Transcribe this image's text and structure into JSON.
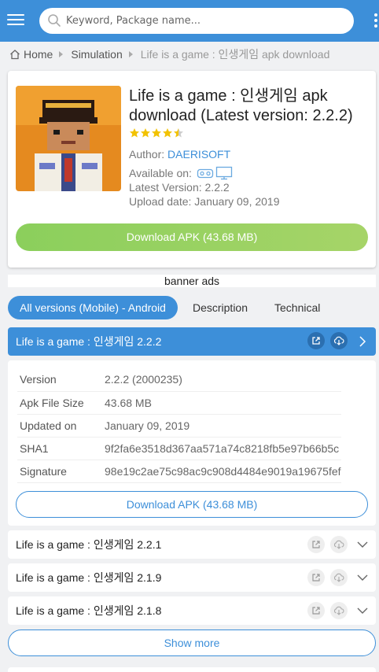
{
  "header": {
    "search_placeholder": "Keyword, Package name...",
    "accent_color": "#3d8fd9"
  },
  "breadcrumb": {
    "home": "Home",
    "category": "Simulation",
    "current": "Life is a game : 인생게임 apk download"
  },
  "app": {
    "title": "Life is a game : 인생게임 apk download (Latest version: 2.2.2)",
    "rating_stars": 4.5,
    "author_label": "Author:",
    "author": "DAERISOFT",
    "available_label": "Available on:",
    "platform_icons": [
      "vr-headset-icon",
      "tv-icon"
    ],
    "latest_version_label": "Latest Version:",
    "latest_version": "2.2.2",
    "upload_date_label": "Upload date:",
    "upload_date": "January 09, 2019",
    "download_label": "Download APK (43.68 MB)"
  },
  "banner": "banner ads",
  "tabs": [
    {
      "label": "All versions (Mobile) - Android",
      "active": true
    },
    {
      "label": "Description",
      "active": false
    },
    {
      "label": "Technical",
      "active": false
    }
  ],
  "current_version": {
    "title": "Life is a game : 인생게임 2.2.2",
    "details": [
      {
        "key": "Version",
        "value": "2.2.2 (2000235)"
      },
      {
        "key": "Apk File Size",
        "value": "43.68 MB"
      },
      {
        "key": "Updated on",
        "value": "January 09, 2019"
      },
      {
        "key": "SHA1",
        "value": "9f2fa6e3518d367aa571a74c8218fb5e97b66b5c"
      },
      {
        "key": "Signature",
        "value": "98e19c2ae75c98ac9c908d4484e9019a19675fef"
      }
    ],
    "download_label": "Download APK (43.68 MB)"
  },
  "other_versions": [
    {
      "title": "Life is a game : 인생게임 2.2.1"
    },
    {
      "title": "Life is a game : 인생게임 2.1.9"
    },
    {
      "title": "Life is a game : 인생게임 2.1.8"
    }
  ],
  "show_more": "Show more"
}
